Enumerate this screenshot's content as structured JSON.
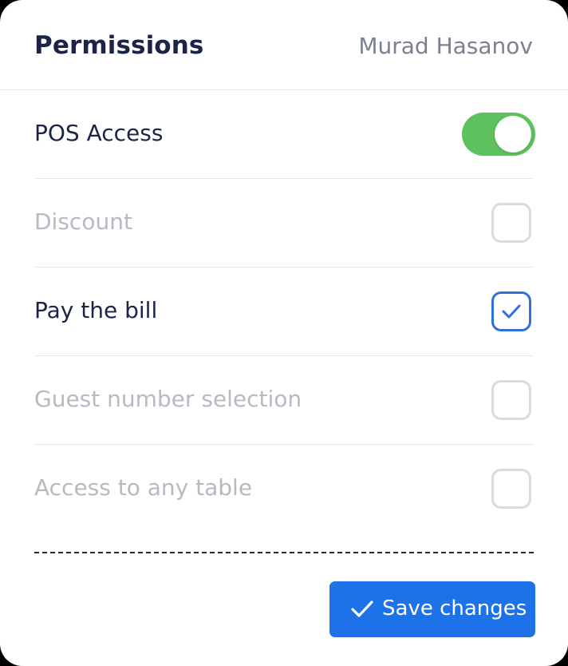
{
  "header": {
    "title": "Permissions",
    "user_name": "Murad Hasanov"
  },
  "permissions": [
    {
      "label": "POS Access",
      "control": "toggle",
      "value": true
    },
    {
      "label": "Discount",
      "control": "checkbox",
      "value": false
    },
    {
      "label": "Pay the bill",
      "control": "checkbox",
      "value": true
    },
    {
      "label": "Guest number selection",
      "control": "checkbox",
      "value": false
    },
    {
      "label": "Access to any table",
      "control": "checkbox",
      "value": false
    }
  ],
  "footer": {
    "save_label": "Save changes",
    "save_icon": "check-icon"
  },
  "colors": {
    "accent": "#1e72e8",
    "toggle_on": "#5dc25e",
    "title_text": "#1c2448",
    "muted_text": "#b8bac2"
  }
}
